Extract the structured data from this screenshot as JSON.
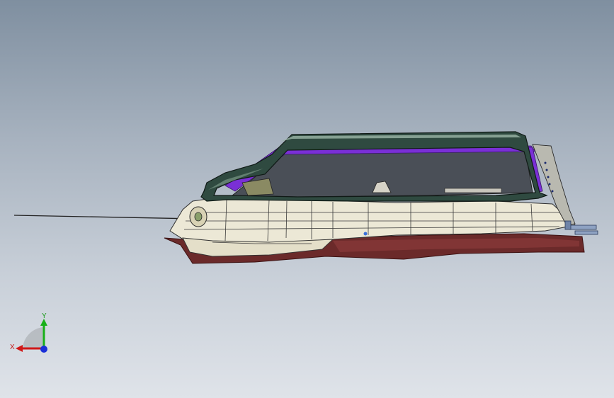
{
  "viewport": {
    "background_top": "#7f8fa0",
    "background_bottom": "#dfe3e9"
  },
  "triad": {
    "x_label": "X",
    "y_label": "Y",
    "x_color": "#d01818",
    "y_color": "#18b018",
    "z_color": "#1a2fd8"
  },
  "model": {
    "frame_color": "#2f4a40",
    "seal_color": "#7a2fd6",
    "body_color": "#ece8d6",
    "trim_color": "#6b2a2a",
    "glass_color": "#4a4f57",
    "clip_color": "#7f93ad"
  }
}
